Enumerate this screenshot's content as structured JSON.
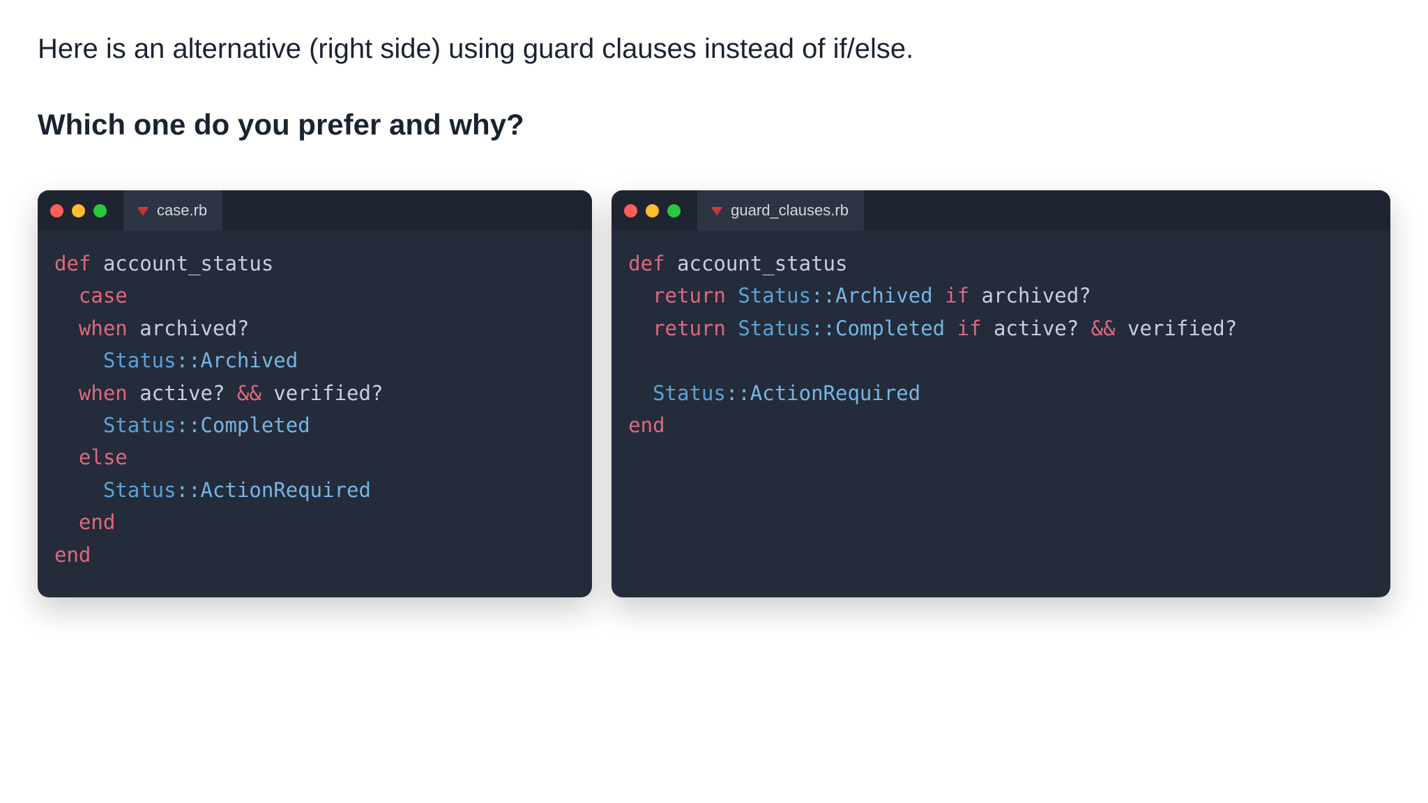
{
  "intro": "Here is an alternative (right side) using guard clauses instead of if/else.",
  "question": "Which one do you prefer and why?",
  "left": {
    "filename": "case.rb",
    "code": {
      "l1_def": "def",
      "l1_name": " account_status",
      "l2_case": "  case",
      "l3_when": "  when",
      "l3_call": " archived?",
      "l4_const": "    Status",
      "l4_rest": "::Archived",
      "l5_when": "  when",
      "l5_call1": " active? ",
      "l5_op": "&&",
      "l5_call2": " verified?",
      "l6_const": "    Status",
      "l6_rest": "::Completed",
      "l7_else": "  else",
      "l8_const": "    Status",
      "l8_rest": "::ActionRequired",
      "l9_end": "  end",
      "l10_end": "end"
    }
  },
  "right": {
    "filename": "guard_clauses.rb",
    "code": {
      "l1_def": "def",
      "l1_name": " account_status",
      "l2_ret": "  return",
      "l2_const": " Status",
      "l2_rest": "::Archived ",
      "l2_if": "if",
      "l2_call": " archived?",
      "l3_ret": "  return",
      "l3_const": " Status",
      "l3_rest": "::Completed ",
      "l3_if": "if",
      "l3_call1": " active? ",
      "l3_op": "&&",
      "l3_call2": " verified?",
      "l4_blank": "",
      "l5_const": "  Status",
      "l5_rest": "::ActionRequired",
      "l6_end": "end"
    }
  }
}
